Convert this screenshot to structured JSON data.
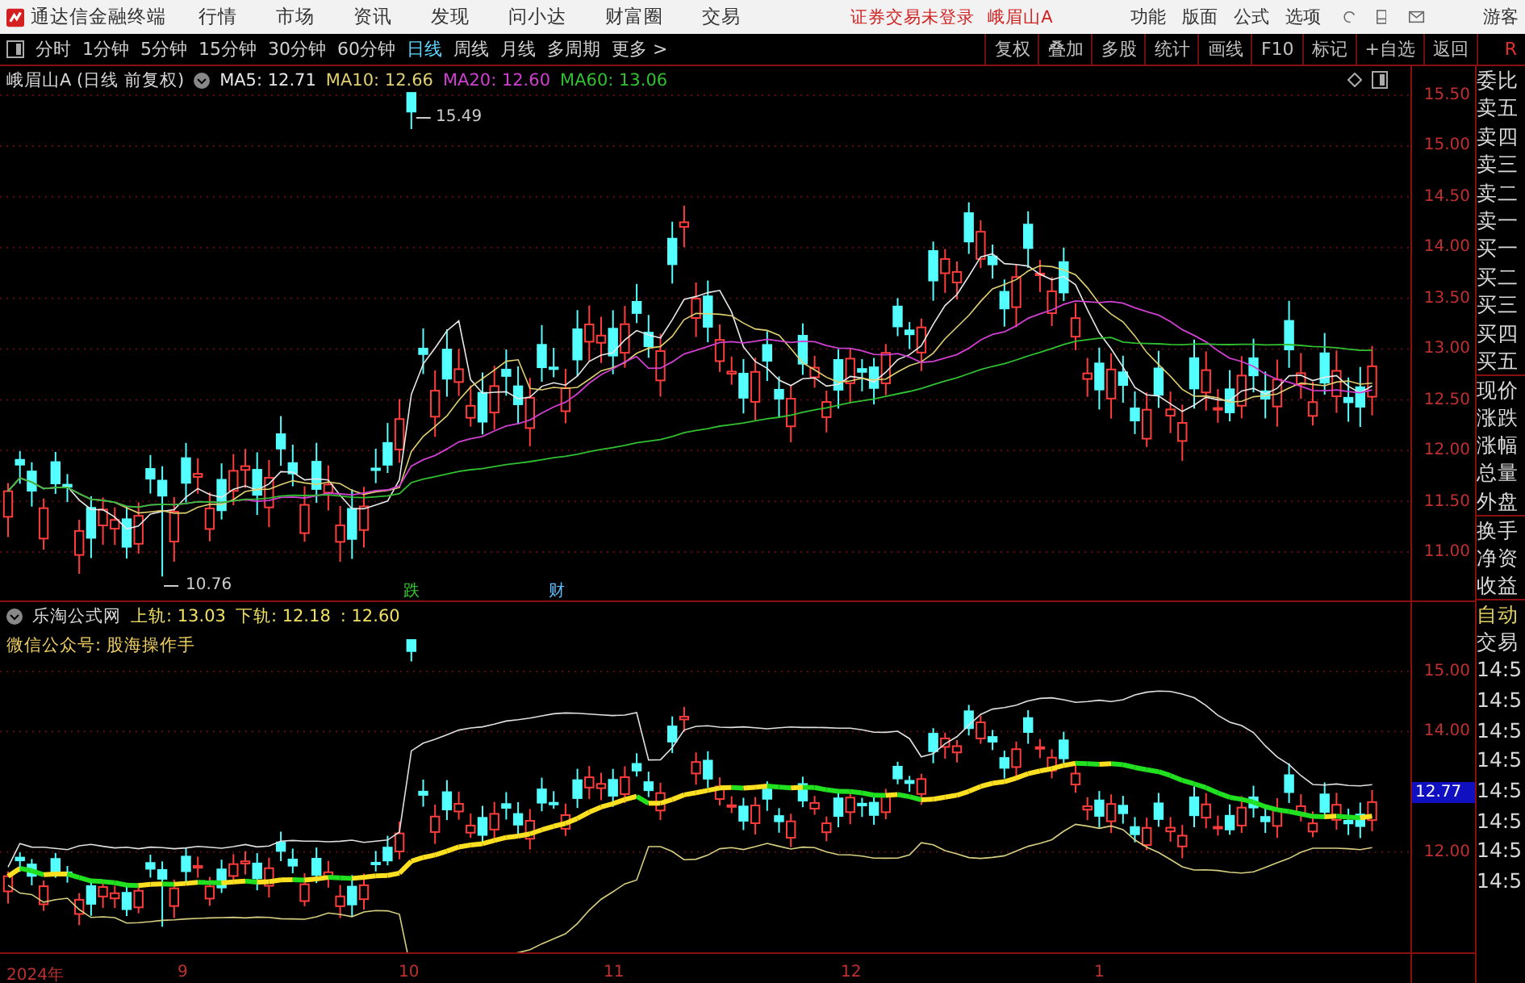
{
  "menubar": {
    "app_name": "通达信金融终端",
    "menu": [
      "行情",
      "市场",
      "资讯",
      "发现",
      "问小达",
      "财富圈",
      "交易"
    ],
    "status": "证券交易未登录",
    "stock": "峨眉山A",
    "right_menu": [
      "功能",
      "版面",
      "公式",
      "选项"
    ],
    "user": "游客"
  },
  "toolbar": {
    "periods": [
      {
        "label": "分时",
        "selected": false
      },
      {
        "label": "1分钟",
        "selected": false
      },
      {
        "label": "5分钟",
        "selected": false
      },
      {
        "label": "15分钟",
        "selected": false
      },
      {
        "label": "30分钟",
        "selected": false
      },
      {
        "label": "60分钟",
        "selected": false
      },
      {
        "label": "日线",
        "selected": true
      },
      {
        "label": "周线",
        "selected": false
      },
      {
        "label": "月线",
        "selected": false
      },
      {
        "label": "多周期",
        "selected": false
      },
      {
        "label": "更多 >",
        "selected": false
      }
    ],
    "buttons": [
      "复权",
      "叠加",
      "多股",
      "统计",
      "画线",
      "F10",
      "标记",
      "+自选",
      "返回"
    ],
    "corner": "R"
  },
  "main_chart": {
    "title": "峨眉山A (日线 前复权)",
    "ma": [
      {
        "label": "MA5: 12.71",
        "color": "#e8e8e8"
      },
      {
        "label": "MA10: 12.66",
        "color": "#e0d070"
      },
      {
        "label": "MA20: 12.60",
        "color": "#d040d0"
      },
      {
        "label": "MA60: 13.06",
        "color": "#30c030"
      }
    ],
    "high_label": "15.49",
    "low_label": "10.76",
    "markers": [
      {
        "text": "跌",
        "color": "#30d030"
      },
      {
        "text": "财",
        "color": "#60c0ff"
      }
    ],
    "yticks": [
      "15.50",
      "15.00",
      "14.50",
      "14.00",
      "13.50",
      "13.00",
      "12.50",
      "12.00",
      "11.50",
      "11.00"
    ]
  },
  "indicator": {
    "name": "乐淘公式网",
    "upper": "上轨: 13.03",
    "lower": "下轨: 12.18",
    "mid": ": 12.60",
    "note": "微信公众号: 股海操作手",
    "yticks": [
      "15.00",
      "14.00",
      "12.00"
    ],
    "current": "12.77"
  },
  "x_axis": [
    "2024年",
    "9",
    "10",
    "11",
    "12",
    "1"
  ],
  "side_panel": {
    "labels": [
      "委比",
      "卖五",
      "卖四",
      "卖三",
      "卖二",
      "卖一",
      "买一",
      "买二",
      "买三",
      "买四",
      "买五",
      "现价",
      "涨跌",
      "涨幅",
      "总量",
      "外盘",
      "换手",
      "净资",
      "收益"
    ],
    "mode": "自动",
    "trade": "交易",
    "times": [
      "14:5",
      "14:5",
      "14:5",
      "14:5",
      "14:5",
      "14:5",
      "14:5",
      "14:5"
    ]
  }
}
